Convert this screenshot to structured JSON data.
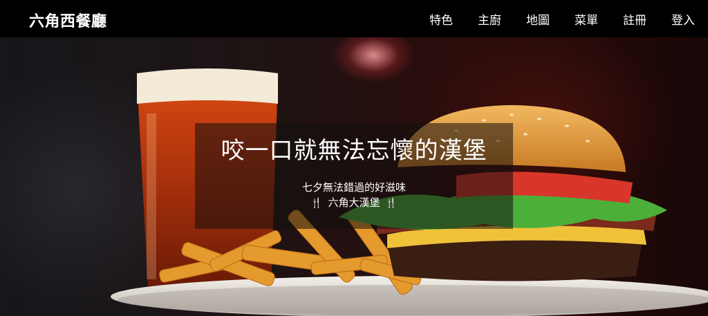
{
  "brand": {
    "title": "六角西餐廳"
  },
  "nav": {
    "items": [
      {
        "label": "特色"
      },
      {
        "label": "主廚"
      },
      {
        "label": "地圖"
      },
      {
        "label": "菜單"
      },
      {
        "label": "註冊"
      },
      {
        "label": "登入"
      }
    ]
  },
  "hero": {
    "headline": "咬一口就無法忘懷的漢堡",
    "subline": "七夕無法錯過的好滋味",
    "product": "六角大漢堡",
    "icon": "utensils-icon",
    "image_subject": "burger-with-fries-and-beer"
  },
  "colors": {
    "navbar_bg": "#000000",
    "nav_text": "#ffffff",
    "caption_bg": "rgba(20,15,15,0.55)"
  }
}
